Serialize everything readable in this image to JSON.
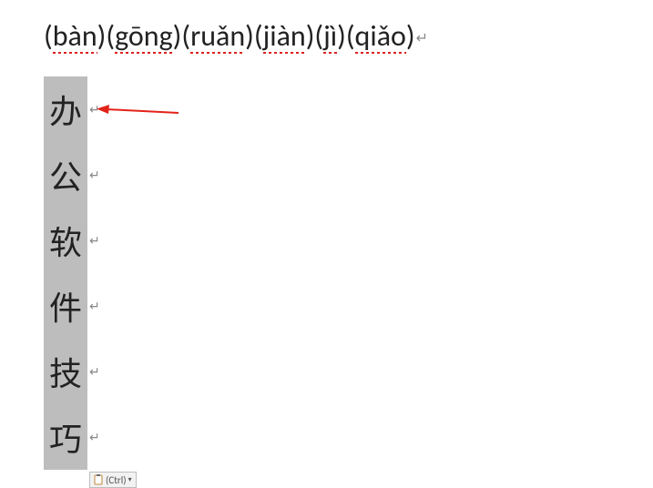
{
  "pinyin": [
    "bàn",
    "gōng",
    "ruǎn",
    "jiàn",
    "jì",
    "qiǎo"
  ],
  "chars": [
    "办",
    "公",
    "软",
    "件",
    "技",
    "巧"
  ],
  "marks": {
    "para": "↵",
    "line": "↵"
  },
  "paste": {
    "label": "(Ctrl)"
  },
  "arrow_color": "#e2231a"
}
